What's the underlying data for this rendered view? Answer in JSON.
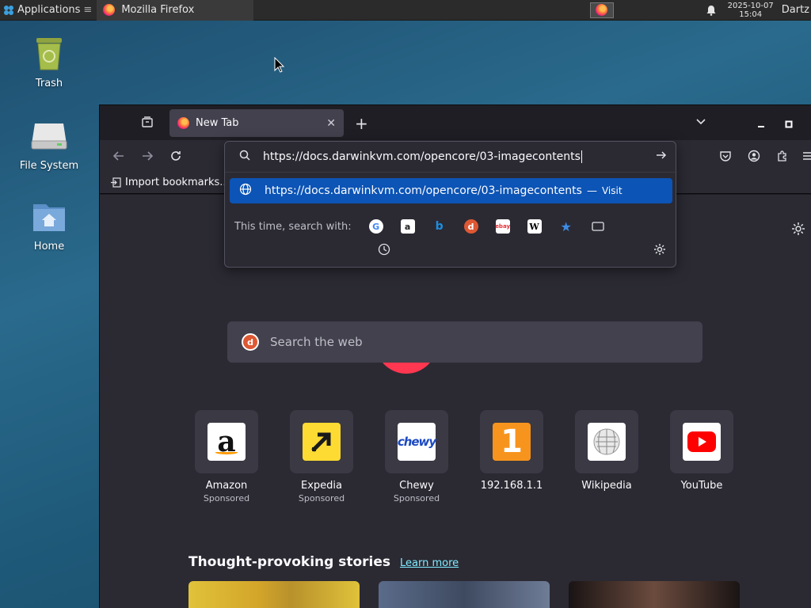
{
  "panel": {
    "applications_label": "Applications",
    "task_title": "Mozilla Firefox",
    "clock_date": "2025-10-07",
    "clock_time": "15:04",
    "user": "Dartz"
  },
  "desktop": {
    "icons": [
      {
        "label": "Trash"
      },
      {
        "label": "File System"
      },
      {
        "label": "Home"
      }
    ]
  },
  "browser": {
    "tab_title": "New Tab",
    "bookmarks_item": "Import bookmarks...",
    "url_value": "https://docs.darwinkvm.com/opencore/03-imagecontents",
    "result_url": "https://docs.darwinkvm.com/opencore/03-imagecontents",
    "result_separator": "—",
    "result_action": "Visit",
    "search_with_label": "This time, search with:",
    "search_placeholder": "Search the web",
    "top_sites": [
      {
        "name": "Amazon",
        "sponsored": "Sponsored"
      },
      {
        "name": "Expedia",
        "sponsored": "Sponsored"
      },
      {
        "name": "Chewy",
        "sponsored": "Sponsored"
      },
      {
        "name": "192.168.1.1",
        "sponsored": ""
      },
      {
        "name": "Wikipedia",
        "sponsored": ""
      },
      {
        "name": "YouTube",
        "sponsored": ""
      }
    ],
    "stories_title": "Thought-provoking stories",
    "learn_more": "Learn more"
  }
}
